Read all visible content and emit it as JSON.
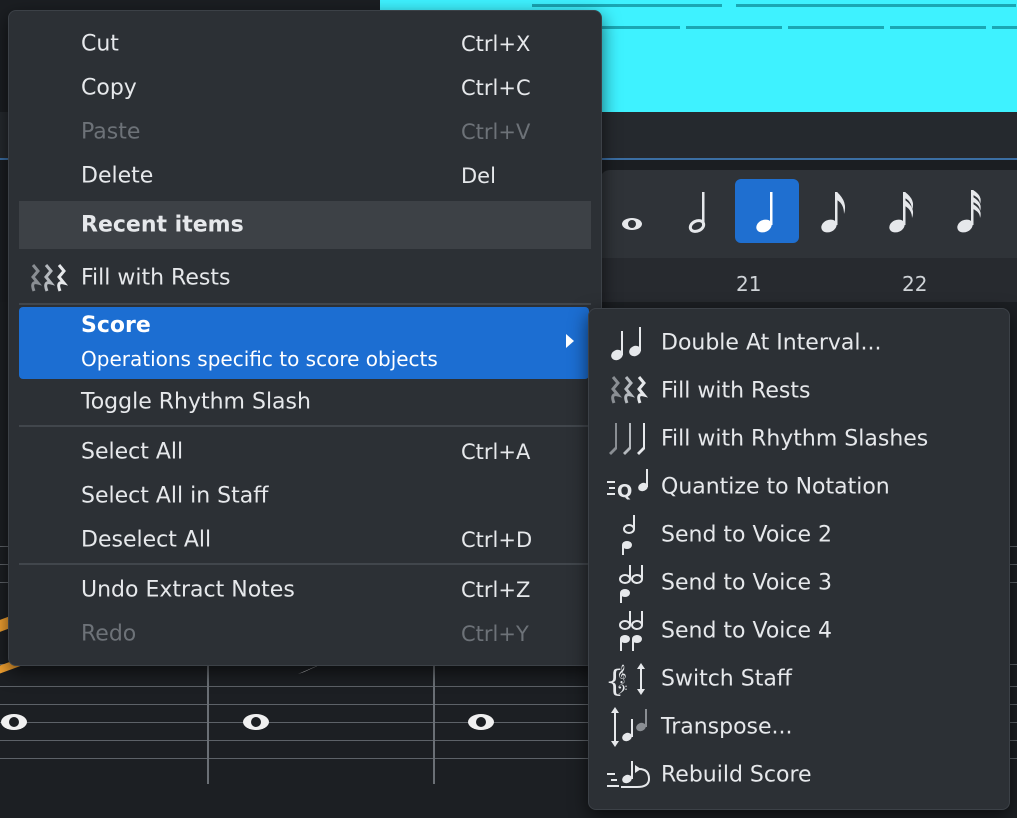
{
  "context_menu": {
    "items_top": [
      {
        "label": "Cut",
        "shortcut": "Ctrl+X",
        "enabled": true
      },
      {
        "label": "Copy",
        "shortcut": "Ctrl+C",
        "enabled": true
      },
      {
        "label": "Paste",
        "shortcut": "Ctrl+V",
        "enabled": false
      },
      {
        "label": "Delete",
        "shortcut": "Del",
        "enabled": true
      }
    ],
    "recent_header": "Recent items",
    "recent_fill_rests": {
      "label": "Fill with Rests",
      "icon": "rests-icon"
    },
    "score": {
      "label": "Score",
      "subtitle": "Operations specific to score objects"
    },
    "toggle_rhythm_slash": "Toggle Rhythm Slash",
    "select_group": [
      {
        "label": "Select All",
        "shortcut": "Ctrl+A",
        "enabled": true
      },
      {
        "label": "Select All in Staff",
        "shortcut": "",
        "enabled": true
      },
      {
        "label": "Deselect All",
        "shortcut": "Ctrl+D",
        "enabled": true
      }
    ],
    "undo_group": [
      {
        "label": "Undo Extract Notes",
        "shortcut": "Ctrl+Z",
        "enabled": true
      },
      {
        "label": "Redo",
        "shortcut": "Ctrl+Y",
        "enabled": false
      }
    ]
  },
  "submenu": {
    "items": [
      {
        "label": "Double At Interval...",
        "icon": "double-notes-icon"
      },
      {
        "label": "Fill with Rests",
        "icon": "rests-icon"
      },
      {
        "label": "Fill with Rhythm Slashes",
        "icon": "rhythm-slashes-icon"
      },
      {
        "label": "Quantize to Notation",
        "icon": "quantize-icon"
      },
      {
        "label": "Send to Voice 2",
        "icon": "voice-2-icon"
      },
      {
        "label": "Send to Voice 3",
        "icon": "voice-3-icon"
      },
      {
        "label": "Send to Voice 4",
        "icon": "voice-4-icon"
      },
      {
        "label": "Switch Staff",
        "icon": "switch-staff-icon"
      },
      {
        "label": "Transpose...",
        "icon": "transpose-icon"
      },
      {
        "label": "Rebuild Score",
        "icon": "rebuild-score-icon"
      }
    ]
  },
  "duration_toolbar": {
    "buttons": [
      "whole-note-icon",
      "half-note-icon",
      "quarter-note-icon",
      "eighth-note-icon",
      "sixteenth-note-icon",
      "thirty-second-note-icon"
    ],
    "selected": "quarter-note-icon",
    "accent": "#1f6fd0"
  },
  "ruler": {
    "bars": [
      "21",
      "22"
    ]
  },
  "colors": {
    "menu_bg": "#2c3035",
    "highlight": "#1c6ed2",
    "cyan_region": "#3ef2ff",
    "disabled_text": "#6d7278"
  }
}
